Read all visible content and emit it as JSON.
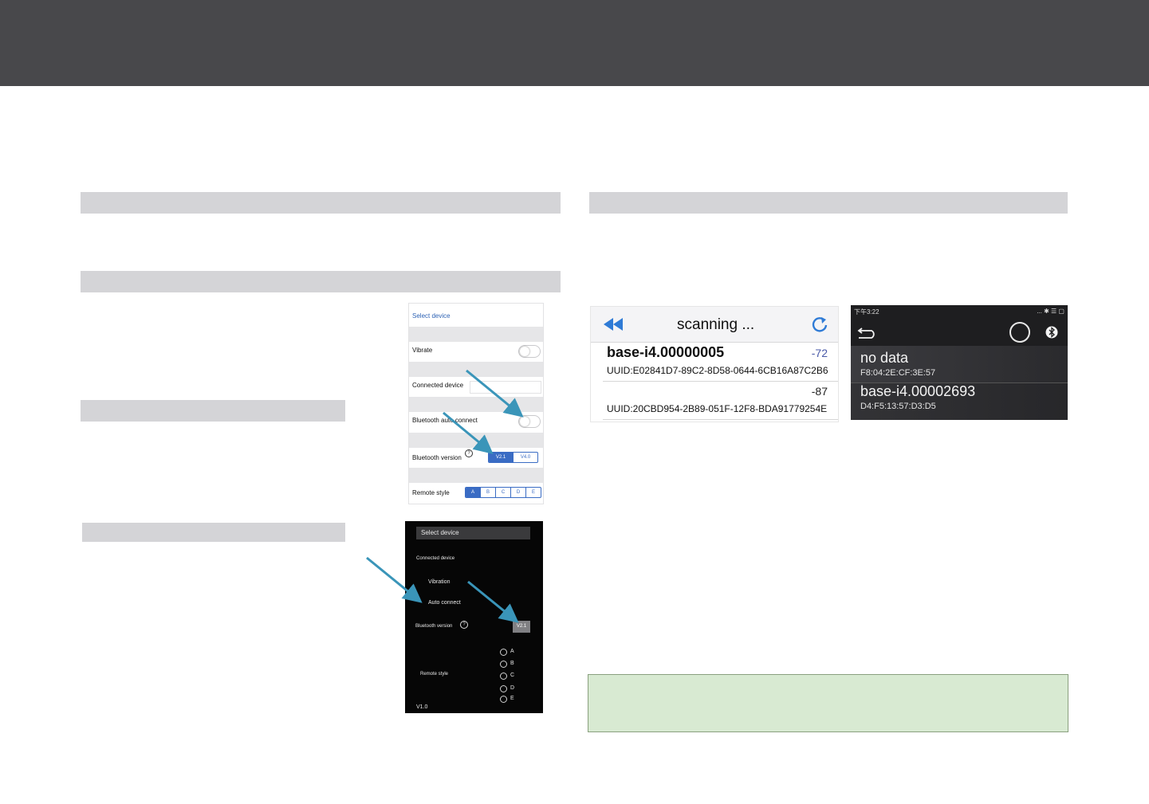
{
  "colors": {
    "header": "#48484b",
    "section_bar": "#d4d4d7",
    "note_box": "#d8ead2",
    "arrow": "#3a95b9",
    "ios_accent": "#3a6cc4"
  },
  "ios_settings": {
    "title": "Select device",
    "vibrate": "Vibrate",
    "connected_device": "Connected device",
    "auto_connect": "Bluetooth auto connect",
    "bt_version": "Bluetooth version",
    "qmark": "?",
    "versions": [
      "V2.1",
      "V4.0"
    ],
    "remote_style": "Remote style",
    "styles": [
      "A",
      "B",
      "C",
      "D",
      "E"
    ]
  },
  "android_settings": {
    "title": "Select device",
    "connected_device": "Connected device",
    "vibration": "Vibration",
    "auto_connect": "Auto connect",
    "bt_version": "Bluetooth version",
    "qmark": "?",
    "version": "V2.1",
    "remote_style": "Remote style",
    "styles": [
      "A",
      "B",
      "C",
      "D",
      "E"
    ],
    "footer": "V1.0"
  },
  "scan_list": {
    "title": "scanning ...",
    "back_icon": "rewind-icon",
    "refresh_icon": "refresh-icon",
    "devices": [
      {
        "name": "base-i4.00000005",
        "rssi": "-72",
        "uuid": "UUID:E02841D7-89C2-8D58-0644-6CB16A87C2B6"
      },
      {
        "name": "",
        "rssi": "-87",
        "uuid": "UUID:20CBD954-2B89-051F-12F8-BDA91779254E"
      }
    ]
  },
  "android_list": {
    "status_time": "下午3:22",
    "status_icons": "... ✱ ☰ ▢",
    "back_icon": "back-arrow-icon",
    "devices": [
      {
        "name": "no data",
        "mac": "F8:04:2E:CF:3E:57"
      },
      {
        "name": "base-i4.00002693",
        "mac": "D4:F5:13:57:D3:D5"
      }
    ]
  }
}
